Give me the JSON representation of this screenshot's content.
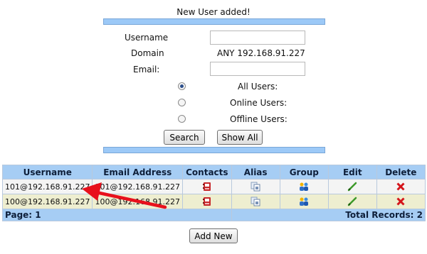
{
  "status_message": "New User added!",
  "form": {
    "username_label": "Username",
    "username_value": "",
    "domain_label": "Domain",
    "domain_value": "ANY 192.168.91.227",
    "email_label": "Email:",
    "email_value": "",
    "filters": [
      {
        "label": "All Users:",
        "selected": true
      },
      {
        "label": "Online Users:",
        "selected": false
      },
      {
        "label": "Offline Users:",
        "selected": false
      }
    ],
    "search_label": "Search",
    "show_all_label": "Show All"
  },
  "table": {
    "headers": [
      "Username",
      "Email Address",
      "Contacts",
      "Alias",
      "Group",
      "Edit",
      "Delete"
    ],
    "rows": [
      {
        "username": "101@192.168.91.227",
        "email": "101@192.168.91.227"
      },
      {
        "username": "100@192.168.91.227",
        "email": "100@192.168.91.227"
      }
    ],
    "page_text": "Page: 1",
    "total_text": "Total Records: 2"
  },
  "add_new_label": "Add New",
  "colors": {
    "header_bg": "#a6cdf4",
    "row_alt_bg": "#eeeed0",
    "annotation_arrow": "#e8101c"
  },
  "icons": {
    "contacts": "phone-book-icon",
    "alias": "alias-card-icon",
    "group": "user-group-icon",
    "edit": "pencil-icon",
    "delete": "red-x-icon"
  }
}
